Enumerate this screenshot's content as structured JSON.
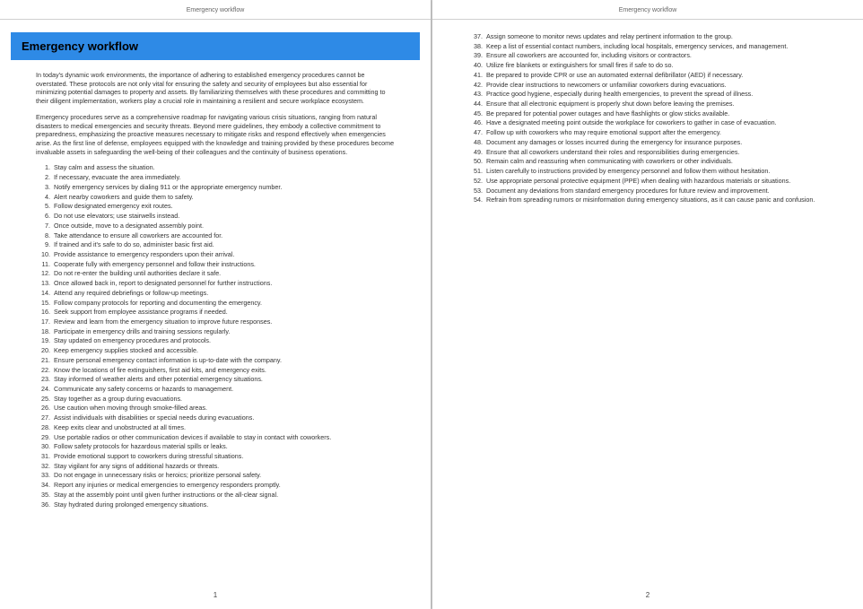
{
  "running_header": "Emergency workflow",
  "title": "Emergency workflow",
  "intro_paragraphs": [
    "In today's dynamic work environments, the importance of adhering to established emergency procedures cannot be overstated. These protocols are not only vital for ensuring the safety and security of employees but also essential for minimizing potential damages to property and assets. By familiarizing themselves with these procedures and committing to their diligent implementation, workers play a crucial role in maintaining a resilient and secure workplace ecosystem.",
    "Emergency procedures serve as a comprehensive roadmap for navigating various crisis situations, ranging from natural disasters to medical emergencies and security threats. Beyond mere guidelines, they embody a collective commitment to preparedness, emphasizing the proactive measures necessary to mitigate risks and respond effectively when emergencies arise. As the first line of defense, employees equipped with the knowledge and training provided by these procedures become invaluable assets in safeguarding the well-being of their colleagues and the continuity of business operations."
  ],
  "steps_page1": [
    "Stay calm and assess the situation.",
    "If necessary, evacuate the area immediately.",
    "Notify emergency services by dialing 911 or the appropriate emergency number.",
    "Alert nearby coworkers and guide them to safety.",
    "Follow designated emergency exit routes.",
    "Do not use elevators; use stairwells instead.",
    "Once outside, move to a designated assembly point.",
    "Take attendance to ensure all coworkers are accounted for.",
    "If trained and it's safe to do so, administer basic first aid.",
    "Provide assistance to emergency responders upon their arrival.",
    "Cooperate fully with emergency personnel and follow their instructions.",
    "Do not re-enter the building until authorities declare it safe.",
    "Once allowed back in, report to designated personnel for further instructions.",
    "Attend any required debriefings or follow-up meetings.",
    "Follow company protocols for reporting and documenting the emergency.",
    "Seek support from employee assistance programs if needed.",
    "Review and learn from the emergency situation to improve future responses.",
    "Participate in emergency drills and training sessions regularly.",
    "Stay updated on emergency procedures and protocols.",
    "Keep emergency supplies stocked and accessible.",
    "Ensure personal emergency contact information is up-to-date with the company.",
    "Know the locations of fire extinguishers, first aid kits, and emergency exits.",
    "Stay informed of weather alerts and other potential emergency situations.",
    "Communicate any safety concerns or hazards to management.",
    "Stay together as a group during evacuations.",
    "Use caution when moving through smoke-filled areas.",
    "Assist individuals with disabilities or special needs during evacuations.",
    "Keep exits clear and unobstructed at all times.",
    "Use portable radios or other communication devices if available to stay in contact with coworkers.",
    "Follow safety protocols for hazardous material spills or leaks.",
    "Provide emotional support to coworkers during stressful situations.",
    "Stay vigilant for any signs of additional hazards or threats.",
    "Do not engage in unnecessary risks or heroics; prioritize personal safety.",
    "Report any injuries or medical emergencies to emergency responders promptly.",
    "Stay at the assembly point until given further instructions or the all-clear signal.",
    "Stay hydrated during prolonged emergency situations."
  ],
  "steps_page2": [
    "Assign someone to monitor news updates and relay pertinent information to the group.",
    "Keep a list of essential contact numbers, including local hospitals, emergency services, and management.",
    "Ensure all coworkers are accounted for, including visitors or contractors.",
    "Utilize fire blankets or extinguishers for small fires if safe to do so.",
    "Be prepared to provide CPR or use an automated external defibrillator (AED) if necessary.",
    "Provide clear instructions to newcomers or unfamiliar coworkers during evacuations.",
    "Practice good hygiene, especially during health emergencies, to prevent the spread of illness.",
    "Ensure that all electronic equipment is properly shut down before leaving the premises.",
    "Be prepared for potential power outages and have flashlights or glow sticks available.",
    "Have a designated meeting point outside the workplace for coworkers to gather in case of evacuation.",
    "Follow up with coworkers who may require emotional support after the emergency.",
    "Document any damages or losses incurred during the emergency for insurance purposes.",
    "Ensure that all coworkers understand their roles and responsibilities during emergencies.",
    "Remain calm and reassuring when communicating with coworkers or other individuals.",
    "Listen carefully to instructions provided by emergency personnel and follow them without hesitation.",
    "Use appropriate personal protective equipment (PPE) when dealing with hazardous materials or situations.",
    "Document any deviations from standard emergency procedures for future review and improvement.",
    "Refrain from spreading rumors or misinformation during emergency situations, as it can cause panic and confusion."
  ],
  "page_numbers": {
    "left": "1",
    "right": "2"
  },
  "list_start_page2": 37
}
